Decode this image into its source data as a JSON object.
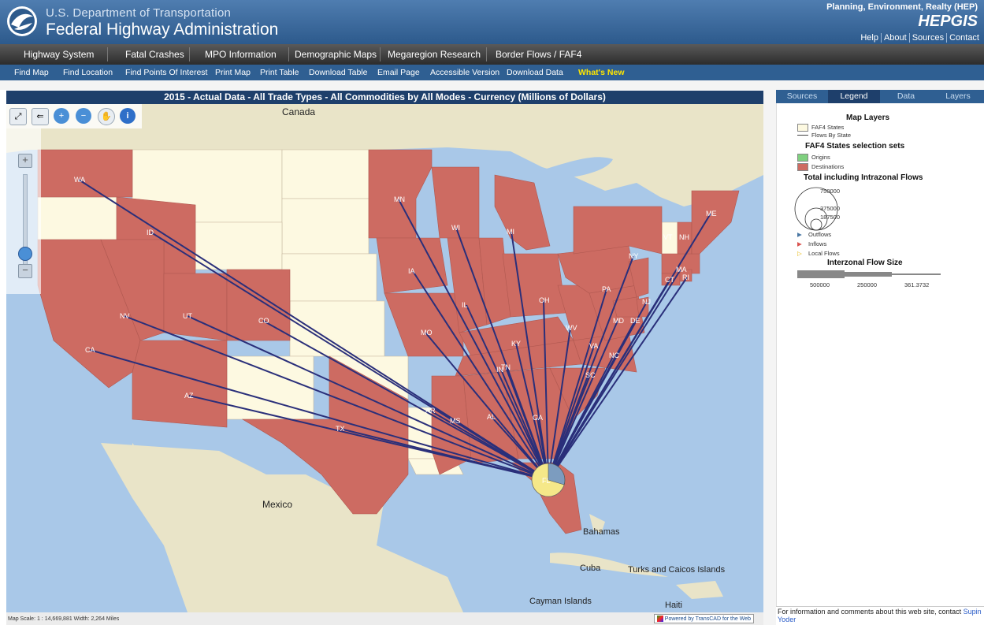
{
  "header": {
    "agency_line1": "U.S. Department of Transportation",
    "agency_line2": "Federal Highway Administration",
    "program": "Planning, Environment, Realty (HEP)",
    "app_title": "HEPGIS",
    "links": [
      "Help",
      "About",
      "Sources",
      "Contact"
    ]
  },
  "main_menu": [
    "Highway System",
    "Fatal Crashes",
    "MPO Information",
    "Demographic Maps",
    "Megaregion Research",
    "Border Flows / FAF4"
  ],
  "sub_menu": [
    "Find Map",
    "Find Location",
    "Find Points Of Interest",
    "Print Map",
    "Print Table",
    "Download Table",
    "Email Page",
    "Accessible Version",
    "Download Data"
  ],
  "whats_new": "What's New",
  "map": {
    "title": "2015 - Actual Data - All Trade Types - All Commodities by All Modes - Currency (Millions of Dollars)",
    "places": [
      "Canada",
      "Mexico",
      "Bahamas",
      "Cuba",
      "Turks and Caicos Islands",
      "Cayman Islands",
      "Haiti"
    ],
    "origin_label": "FL",
    "states": [
      "WA",
      "ID",
      "MN",
      "WI",
      "MI",
      "ME",
      "NY",
      "IA",
      "IL",
      "IN",
      "OH",
      "PA",
      "NJ",
      "MD",
      "DE",
      "MA",
      "NV",
      "UT",
      "CO",
      "CA",
      "AZ",
      "TX",
      "MO",
      "KY",
      "WV",
      "VA",
      "NC",
      "SC",
      "GA",
      "AL",
      "MS",
      "TN",
      "AR",
      "CT",
      "RI",
      "NH",
      "VT"
    ],
    "scale_text": "Map Scale: 1 : 14,669,881   Width: 2,264 Miles",
    "powered_by": "Powered by TransCAD for the Web",
    "colors": {
      "destination": "#cd6b62",
      "faf_state": "#fdf9e1",
      "origin": "#7fd07f",
      "water": "#a9c8e8",
      "land": "#e9e4c8",
      "flow": "#2a2f7a"
    }
  },
  "side": {
    "tabs": [
      "Sources",
      "Legend",
      "Data",
      "Layers"
    ],
    "active_tab": "Legend",
    "legend": {
      "map_layers": "Map Layers",
      "faf4_states": "FAF4 States",
      "flows_by_state": "Flows By State",
      "selection_sets": "FAF4 States selection sets",
      "origins": "Origins",
      "destinations": "Destinations",
      "total_flows": "Total including Intrazonal Flows",
      "circle_values": [
        "750000",
        "375000",
        "187500"
      ],
      "outflows": "Outflows",
      "inflows": "Inflows",
      "local_flows": "Local Flows",
      "interzonal": "Interzonal Flow Size",
      "interzonal_values": [
        "500000",
        "250000",
        "361.3732"
      ]
    },
    "footer_text": "For information and comments about this web site, contact",
    "footer_link": "Supin Yoder"
  }
}
